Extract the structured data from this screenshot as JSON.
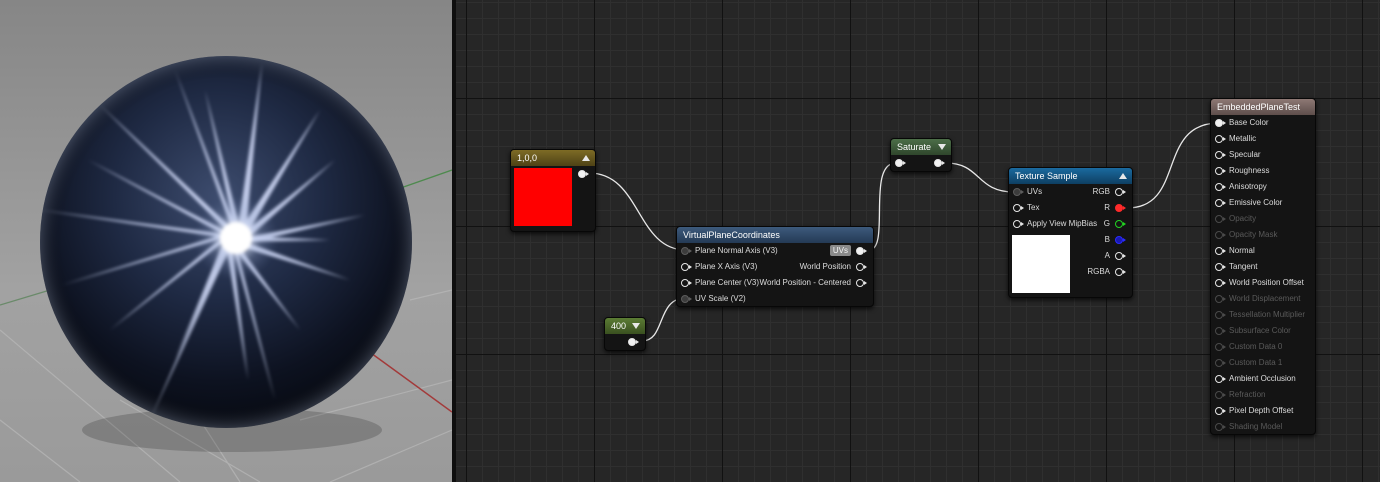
{
  "colors": {
    "viewport_bg": "#9a9a9a",
    "graph_bg": "#262626",
    "wire": "#e8e8e8",
    "constant_header": "#6d5a1a",
    "scalar_header": "#4d6b2c",
    "function_header": "#2f4a6a",
    "texture_header": "#12547f",
    "result_header": "#7e6a66",
    "constant_color": "#ff0000",
    "texture_preview": "#ffffff"
  },
  "viewport": {
    "preview_mesh": "sphere",
    "material_look": "dark navy sphere with white starburst highlight"
  },
  "nodes": {
    "constant3": {
      "title": "1,0,0",
      "preview_color": "#ff0000"
    },
    "scalar": {
      "title": "400"
    },
    "virtual_plane": {
      "title": "VirtualPlaneCoordinates",
      "inputs": [
        "Plane Normal Axis (V3)",
        "Plane X Axis (V3)",
        "Plane Center (V3)",
        "UV Scale (V2)"
      ],
      "outputs": [
        "UVs",
        "World Position",
        "World Position - Centered"
      ]
    },
    "saturate": {
      "title": "Saturate"
    },
    "texture_sample": {
      "title": "Texture Sample",
      "inputs": [
        "UVs",
        "Tex",
        "Apply View MipBias"
      ],
      "outputs": [
        "RGB",
        "R",
        "G",
        "B",
        "A",
        "RGBA"
      ]
    },
    "result": {
      "title": "EmbeddedPlaneTest",
      "pins": [
        {
          "label": "Base Color",
          "enabled": true,
          "connected": true
        },
        {
          "label": "Metallic",
          "enabled": true,
          "connected": false
        },
        {
          "label": "Specular",
          "enabled": true,
          "connected": false
        },
        {
          "label": "Roughness",
          "enabled": true,
          "connected": false
        },
        {
          "label": "Anisotropy",
          "enabled": true,
          "connected": false
        },
        {
          "label": "Emissive Color",
          "enabled": true,
          "connected": false
        },
        {
          "label": "Opacity",
          "enabled": false,
          "connected": false
        },
        {
          "label": "Opacity Mask",
          "enabled": false,
          "connected": false
        },
        {
          "label": "Normal",
          "enabled": true,
          "connected": false
        },
        {
          "label": "Tangent",
          "enabled": true,
          "connected": false
        },
        {
          "label": "World Position Offset",
          "enabled": true,
          "connected": false
        },
        {
          "label": "World Displacement",
          "enabled": false,
          "connected": false
        },
        {
          "label": "Tessellation Multiplier",
          "enabled": false,
          "connected": false
        },
        {
          "label": "Subsurface Color",
          "enabled": false,
          "connected": false
        },
        {
          "label": "Custom Data 0",
          "enabled": false,
          "connected": false
        },
        {
          "label": "Custom Data 1",
          "enabled": false,
          "connected": false
        },
        {
          "label": "Ambient Occlusion",
          "enabled": true,
          "connected": false
        },
        {
          "label": "Refraction",
          "enabled": false,
          "connected": false
        },
        {
          "label": "Pixel Depth Offset",
          "enabled": true,
          "connected": false
        },
        {
          "label": "Shading Model",
          "enabled": false,
          "connected": false
        }
      ]
    }
  }
}
